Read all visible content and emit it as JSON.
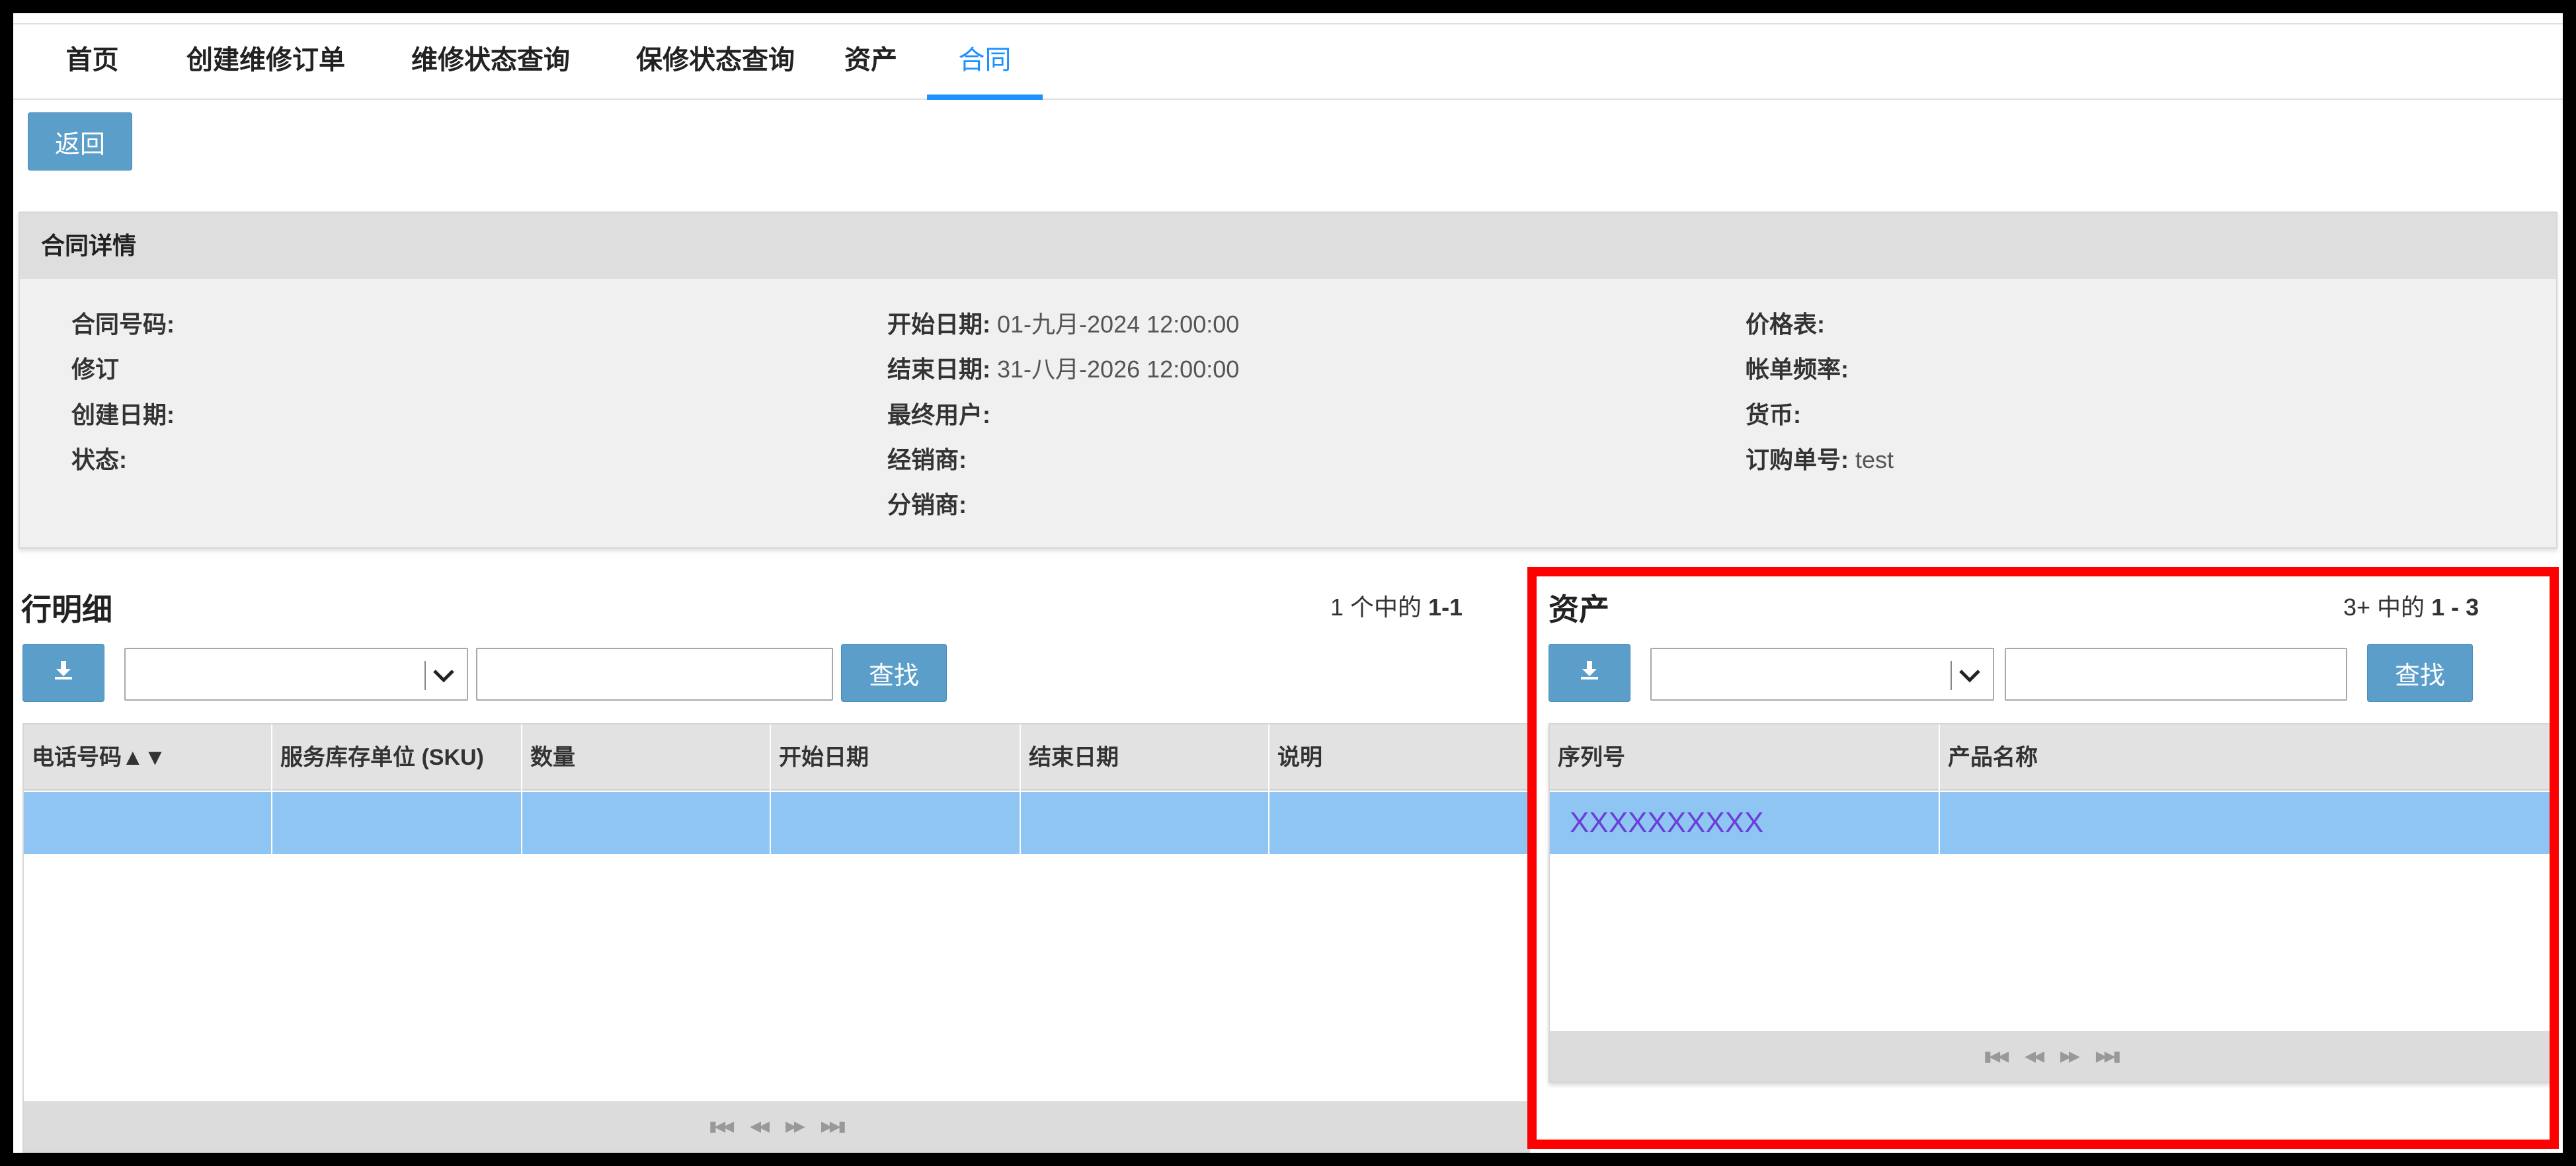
{
  "nav": {
    "tabs": [
      {
        "label": "首页"
      },
      {
        "label": "创建维修订单"
      },
      {
        "label": "维修状态查询"
      },
      {
        "label": "保修状态查询"
      },
      {
        "label": "资产"
      },
      {
        "label": "合同"
      }
    ],
    "active_tab": "合同"
  },
  "back_button": "返回",
  "details": {
    "title": "合同详情",
    "col1": [
      {
        "label": "合同号码:",
        "value": ""
      },
      {
        "label": "修订",
        "value": ""
      },
      {
        "label": "创建日期:",
        "value": ""
      },
      {
        "label": "状态:",
        "value": ""
      }
    ],
    "col2": [
      {
        "label": "开始日期:",
        "value": "01-九月-2024 12:00:00"
      },
      {
        "label": "结束日期:",
        "value": "31-八月-2026 12:00:00"
      },
      {
        "label": "最终用户:",
        "value": ""
      },
      {
        "label": "经销商:",
        "value": ""
      },
      {
        "label": "分销商:",
        "value": ""
      }
    ],
    "col3": [
      {
        "label": "价格表:",
        "value": ""
      },
      {
        "label": "帐单频率:",
        "value": ""
      },
      {
        "label": "货币:",
        "value": ""
      },
      {
        "label": "订购单号:",
        "value": "test"
      }
    ]
  },
  "lines": {
    "title": "行明细",
    "count_prefix": "1 个中的",
    "count_range": "1-1",
    "search_button": "查找",
    "columns": [
      "电话号码▲▼",
      "服务库存单位 (SKU)",
      "数量",
      "开始日期",
      "结束日期",
      "说明"
    ],
    "rows": [
      [
        "",
        "",
        "",
        "",
        "",
        ""
      ]
    ]
  },
  "assets": {
    "title": "资产",
    "count_prefix": "3+ 中的",
    "count_range": "1 - 3",
    "search_button": "查找",
    "columns": [
      "序列号",
      "产品名称"
    ],
    "rows": [
      [
        "XXXXXXXXXX",
        ""
      ]
    ]
  },
  "pager_icons": [
    "first-page-icon",
    "prev-page-icon",
    "next-page-icon",
    "last-page-icon"
  ],
  "colors": {
    "accent": "#1e90ff",
    "button": "#5b9ec9",
    "selected_row": "#8ec5f3",
    "highlight_border": "#ff0000",
    "link": "#6a3fd8"
  }
}
